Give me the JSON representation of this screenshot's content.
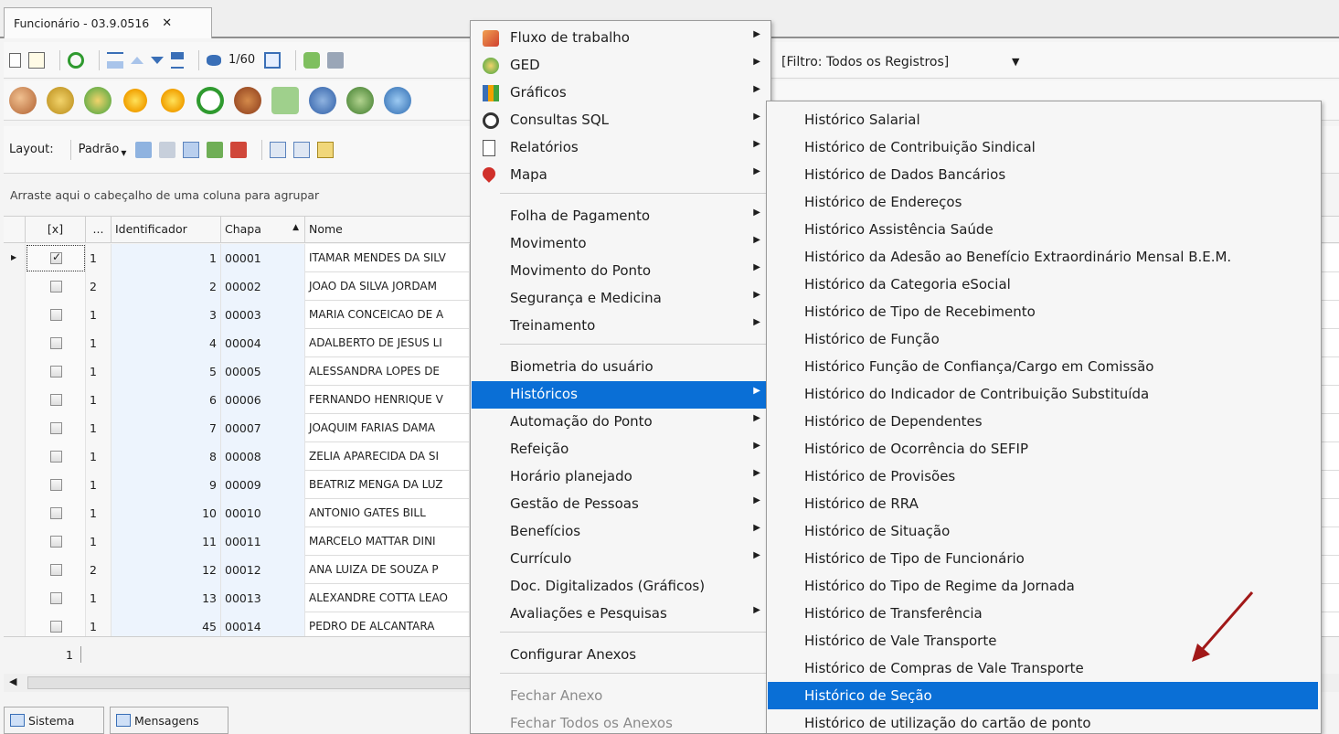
{
  "tab": {
    "title": "Funcionário - 03.9.0516",
    "close": "✕"
  },
  "toolbar": {
    "record_counter": "1/60",
    "layout_label": "Layout:",
    "layout_value": "Padrão",
    "filter": "[Filtro: Todos os Registros]"
  },
  "grid": {
    "group_hint": "Arraste aqui o cabeçalho de uma coluna para agrupar",
    "headers": [
      "[x]",
      "...",
      "Identificador",
      "Chapa",
      "Nome"
    ],
    "rows": [
      {
        "checked": true,
        "group": "1",
        "id": "1",
        "chapa": "00001",
        "nome": "ITAMAR MENDES DA SILV"
      },
      {
        "checked": false,
        "group": "2",
        "id": "2",
        "chapa": "00002",
        "nome": "JOAO DA SILVA JORDAM"
      },
      {
        "checked": false,
        "group": "1",
        "id": "3",
        "chapa": "00003",
        "nome": "MARIA CONCEICAO DE A"
      },
      {
        "checked": false,
        "group": "1",
        "id": "4",
        "chapa": "00004",
        "nome": "ADALBERTO DE JESUS LI"
      },
      {
        "checked": false,
        "group": "1",
        "id": "5",
        "chapa": "00005",
        "nome": "ALESSANDRA LOPES DE"
      },
      {
        "checked": false,
        "group": "1",
        "id": "6",
        "chapa": "00006",
        "nome": "FERNANDO HENRIQUE V"
      },
      {
        "checked": false,
        "group": "1",
        "id": "7",
        "chapa": "00007",
        "nome": "JOAQUIM FARIAS DAMA"
      },
      {
        "checked": false,
        "group": "1",
        "id": "8",
        "chapa": "00008",
        "nome": "ZELIA APARECIDA DA SI"
      },
      {
        "checked": false,
        "group": "1",
        "id": "9",
        "chapa": "00009",
        "nome": "BEATRIZ MENGA DA LUZ"
      },
      {
        "checked": false,
        "group": "1",
        "id": "10",
        "chapa": "00010",
        "nome": "ANTONIO GATES BILL"
      },
      {
        "checked": false,
        "group": "1",
        "id": "11",
        "chapa": "00011",
        "nome": "MARCELO MATTAR DINI"
      },
      {
        "checked": false,
        "group": "2",
        "id": "12",
        "chapa": "00012",
        "nome": "ANA LUIZA  DE SOUZA P"
      },
      {
        "checked": false,
        "group": "1",
        "id": "13",
        "chapa": "00013",
        "nome": "ALEXANDRE COTTA LEAO"
      },
      {
        "checked": false,
        "group": "1",
        "id": "45",
        "chapa": "00014",
        "nome": "PEDRO DE ALCANTARA"
      }
    ],
    "footer_count": "1"
  },
  "bottom_tabs": [
    "Sistema",
    "Mensagens"
  ],
  "context_menu": {
    "items": [
      {
        "label": "Fluxo de trabalho",
        "submenu": true,
        "icon": "workflow-icon"
      },
      {
        "label": "GED",
        "submenu": true,
        "icon": "ged-icon"
      },
      {
        "label": "Gráficos",
        "submenu": true,
        "icon": "chart-icon"
      },
      {
        "label": "Consultas SQL",
        "submenu": true,
        "icon": "sql-query-icon"
      },
      {
        "label": "Relatórios",
        "submenu": true,
        "icon": "report-icon"
      },
      {
        "label": "Mapa",
        "submenu": true,
        "icon": "map-pin-icon"
      },
      {
        "separator": true
      },
      {
        "label": "Folha de Pagamento",
        "submenu": true
      },
      {
        "label": "Movimento",
        "submenu": true
      },
      {
        "label": "Movimento do Ponto",
        "submenu": true
      },
      {
        "label": "Segurança e Medicina",
        "submenu": true
      },
      {
        "label": "Treinamento",
        "submenu": true
      },
      {
        "separator": true
      },
      {
        "label": "Biometria do usuário",
        "submenu": false
      },
      {
        "label": "Históricos",
        "submenu": true,
        "highlight": true
      },
      {
        "label": "Automação do Ponto",
        "submenu": true
      },
      {
        "label": "Refeição",
        "submenu": true
      },
      {
        "label": "Horário planejado",
        "submenu": true
      },
      {
        "label": "Gestão de Pessoas",
        "submenu": true
      },
      {
        "label": "Benefícios",
        "submenu": true
      },
      {
        "label": "Currículo",
        "submenu": true
      },
      {
        "label": "Doc. Digitalizados (Gráficos)",
        "submenu": false
      },
      {
        "label": "Avaliações e Pesquisas",
        "submenu": true
      },
      {
        "separator": true
      },
      {
        "label": "Configurar Anexos",
        "submenu": false
      },
      {
        "separator": true
      },
      {
        "label": "Fechar Anexo",
        "submenu": false,
        "disabled": true
      },
      {
        "label": "Fechar Todos os Anexos",
        "submenu": false,
        "disabled": true
      }
    ]
  },
  "submenu": {
    "items": [
      {
        "label": "Histórico Salarial"
      },
      {
        "label": "Histórico de Contribuição Sindical"
      },
      {
        "label": "Histórico de Dados Bancários"
      },
      {
        "label": "Histórico de Endereços"
      },
      {
        "label": "Histórico Assistência Saúde"
      },
      {
        "label": "Histórico da Adesão ao Benefício Extraordinário Mensal B.E.M."
      },
      {
        "label": "Histórico da Categoria eSocial"
      },
      {
        "label": "Histórico de Tipo de Recebimento"
      },
      {
        "label": "Histórico de Função"
      },
      {
        "label": "Histórico Função de Confiança/Cargo em Comissão"
      },
      {
        "label": "Histórico do Indicador de Contribuição Substituída"
      },
      {
        "label": "Histórico de Dependentes"
      },
      {
        "label": "Histórico de Ocorrência do SEFIP"
      },
      {
        "label": "Histórico de Provisões"
      },
      {
        "label": "Histórico de RRA"
      },
      {
        "label": "Histórico de Situação"
      },
      {
        "label": "Histórico de Tipo de Funcionário"
      },
      {
        "label": "Histórico do Tipo de Regime da Jornada"
      },
      {
        "label": "Histórico de Transferência"
      },
      {
        "label": "Histórico de Vale Transporte"
      },
      {
        "label": "Histórico de Compras de Vale Transporte"
      },
      {
        "label": "Histórico de Seção",
        "highlight": true
      },
      {
        "label": "Histórico de utilização do cartão de ponto"
      }
    ]
  },
  "colors": {
    "highlight": "#0a6fd6",
    "annotation_arrow": "#a11818",
    "row_tint": "#edf4fd"
  }
}
